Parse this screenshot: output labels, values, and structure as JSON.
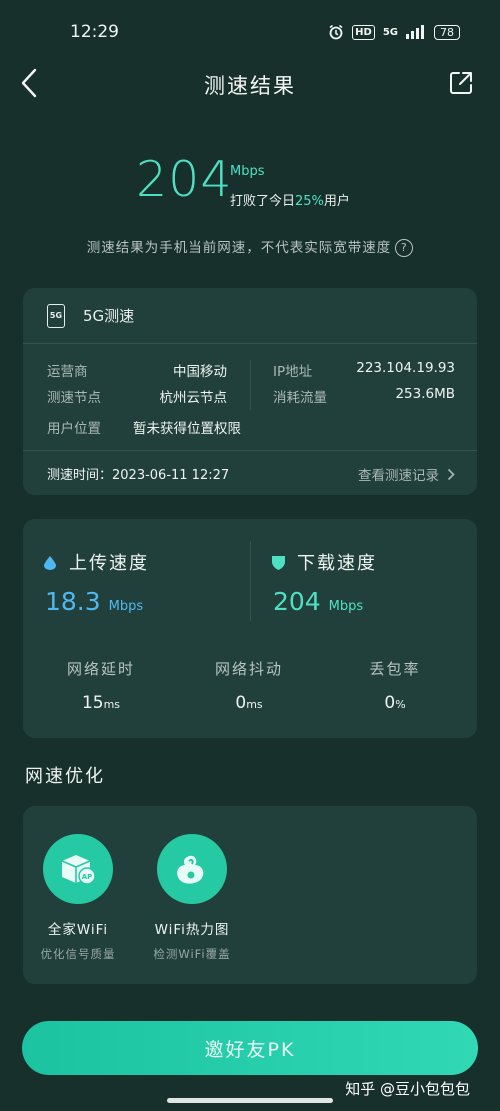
{
  "status_bar": {
    "time": "12:29",
    "hd": "HD",
    "network": "5G",
    "battery": "78"
  },
  "nav": {
    "title": "测速结果"
  },
  "hero": {
    "speed": "204",
    "unit": "Mbps",
    "beat_prefix": "打败了今日",
    "beat_pct": "25%",
    "beat_suffix": "用户",
    "note": "测速结果为手机当前网速，不代表实际宽带速度"
  },
  "info_card": {
    "icon_text": "5G",
    "title": "5G测速",
    "rows": [
      {
        "k1": "运营商",
        "v1": "中国移动",
        "k2": "IP地址",
        "v2": "223.104.19.93"
      },
      {
        "k1": "测速节点",
        "v1": "杭州云节点",
        "k2": "消耗流量",
        "v2": "253.6MB"
      },
      {
        "k1": "用户位置",
        "v1": "暂未获得位置权限"
      }
    ],
    "time_label": "测速时间：2023-06-11 12:27",
    "record_link": "查看测速记录"
  },
  "speed_card": {
    "upload_label": "上传速度",
    "upload_value": "18.3",
    "upload_unit": "Mbps",
    "download_label": "下载速度",
    "download_value": "204",
    "download_unit": "Mbps",
    "metrics": [
      {
        "label": "网络延时",
        "value": "15",
        "unit": "ms"
      },
      {
        "label": "网络抖动",
        "value": "0",
        "unit": "ms"
      },
      {
        "label": "丢包率",
        "value": "0",
        "unit": "%"
      }
    ]
  },
  "optimize": {
    "title": "网速优化",
    "tools": [
      {
        "name": "全家WiFi",
        "desc": "优化信号质量",
        "icon": "ap-box-icon"
      },
      {
        "name": "WiFi热力图",
        "desc": "检测WiFi覆盖",
        "icon": "heatmap-icon"
      }
    ]
  },
  "pk_button": "邀好友PK",
  "watermark": "知乎 @豆小包包包",
  "colors": {
    "accent": "#4fe0c4",
    "upload": "#4fb8f0",
    "background": "#18302c",
    "card": "#22403b",
    "button": "#25c9a3"
  }
}
